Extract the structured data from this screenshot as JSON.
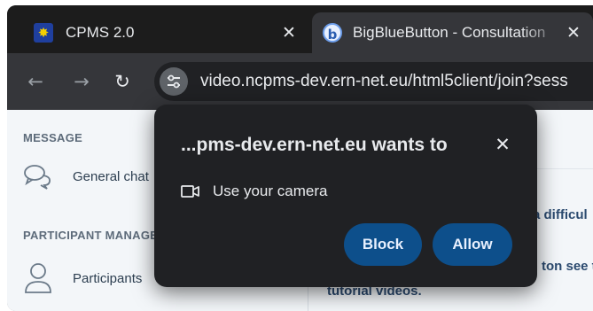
{
  "tabs": [
    {
      "title": "CPMS 2.0",
      "favicon": "eu-flag-icon",
      "active": false
    },
    {
      "title": "BigBlueButton - Consultation",
      "favicon": "bigbluebutton-icon",
      "active": true
    }
  ],
  "toolbar": {
    "url": "video.ncpms-dev.ern-net.eu/html5client/join?sess"
  },
  "bbb": {
    "sections": [
      {
        "heading": "MESSAGE",
        "item_label": "General chat",
        "item_icon": "chat-bubbles-icon"
      },
      {
        "heading": "PARTICIPANT MANAGEMENT",
        "item_label": "Participants",
        "item_icon": "person-icon"
      }
    ],
    "main_text": [
      "a difficul",
      "ton see t",
      "tutorial videos."
    ]
  },
  "permission_dialog": {
    "title": "...pms-dev.ern-net.eu wants to",
    "permission_label": "Use your camera",
    "permission_icon": "camera-icon",
    "block_label": "Block",
    "allow_label": "Allow",
    "button_color": "#0d4f8b"
  }
}
